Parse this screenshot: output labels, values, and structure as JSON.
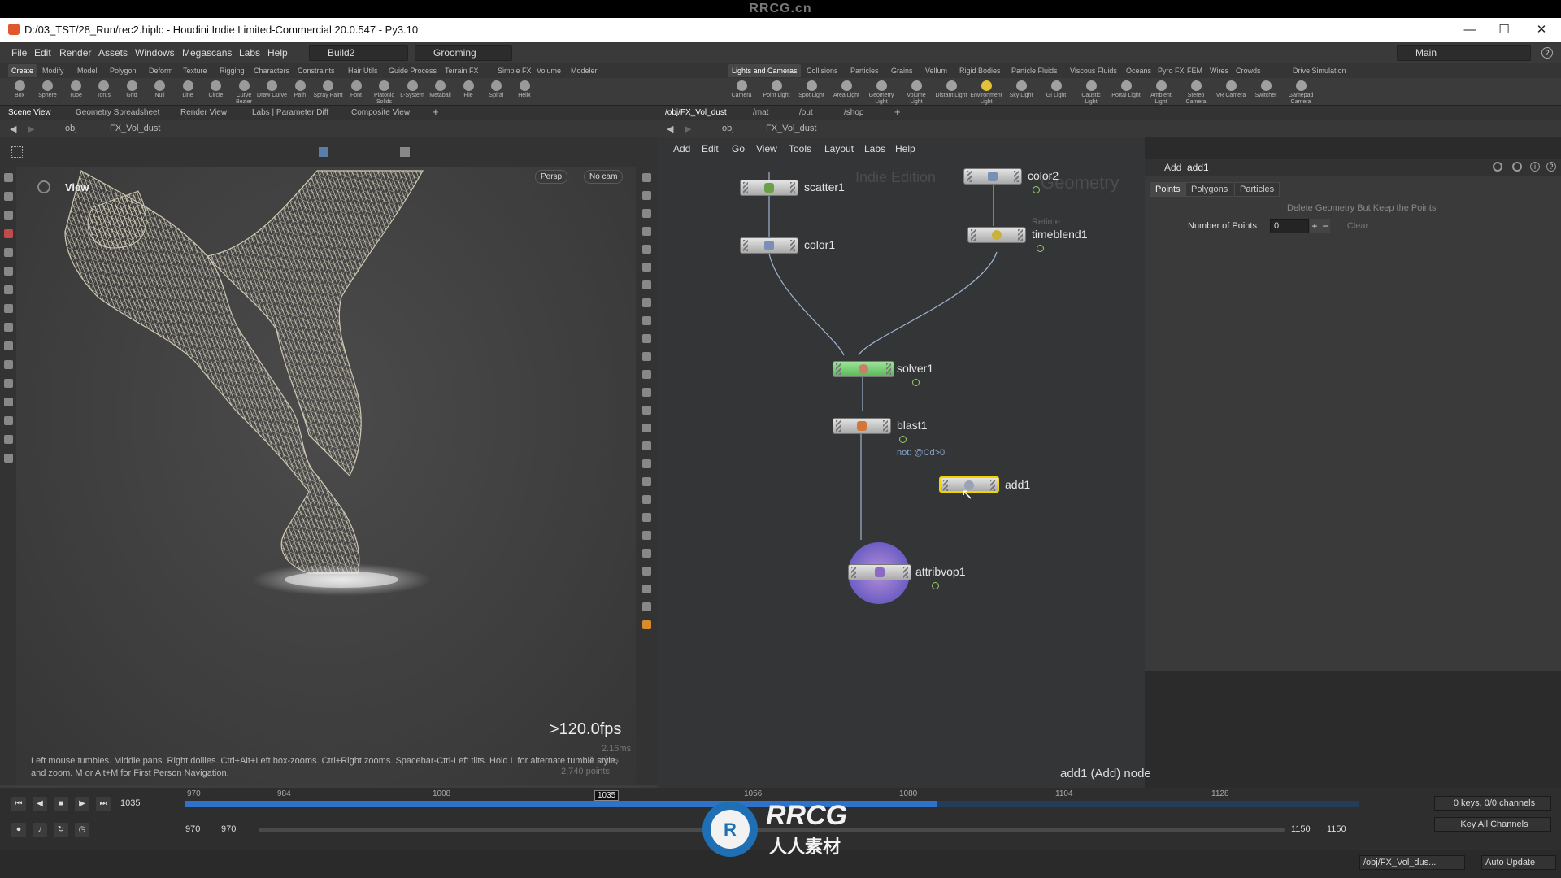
{
  "watermark_top": "RRCG.cn",
  "window": {
    "title": "D:/03_TST/28_Run/rec2.hiplc - Houdini Indie Limited-Commercial 20.0.547 - Py3.10",
    "buttons": [
      "—",
      "☐",
      "✕"
    ]
  },
  "menubar": {
    "items": [
      "File",
      "Edit",
      "Render",
      "Assets",
      "Windows",
      "Megascans",
      "Labs",
      "Help"
    ],
    "build": "Build2",
    "desktop": "Grooming",
    "main": "Main"
  },
  "shelf_tabs_left": [
    "Create",
    "Modify",
    "Model",
    "Polygon",
    "Deform",
    "Texture",
    "Rigging",
    "Characters",
    "Constraints",
    "Hair Utils",
    "Guide Process",
    "Terrain FX",
    "Simple FX",
    "Volume",
    "Modeler"
  ],
  "shelf_tabs_right": [
    "Lights and Cameras",
    "Collisions",
    "Particles",
    "Grains",
    "Vellum",
    "Rigid Bodies",
    "Particle Fluids",
    "Viscous Fluids",
    "Oceans",
    "Pyro FX",
    "FEM",
    "Wires",
    "Crowds",
    "Drive Simulation"
  ],
  "tools_left": [
    "Box",
    "Sphere",
    "Tube",
    "Torus",
    "Grid",
    "Null",
    "Line",
    "Circle",
    "Curve Bezier",
    "Draw Curve",
    "Path",
    "Spray Paint",
    "Font",
    "Platonic Solids",
    "L-System",
    "Metaball",
    "File",
    "Spiral",
    "Helix"
  ],
  "tools_right": [
    "Camera",
    "Point Light",
    "Spot Light",
    "Area Light",
    "Geometry Light",
    "Volume Light",
    "Distant Light",
    "Environment Light",
    "Sky Light",
    "GI Light",
    "Caustic Light",
    "Portal Light",
    "Ambient Light",
    "Stereo Camera",
    "VR Camera",
    "Switcher",
    "Gamepad Camera"
  ],
  "left_pane_tabs": [
    "Scene View",
    "Geometry Spreadsheet",
    "Render View",
    "Labs | Parameter Diff",
    "Composite View"
  ],
  "right_pane_tabs": [
    "/obj/FX_Vol_dust",
    "/mat",
    "/out",
    "/shop"
  ],
  "left_path": {
    "root": "obj",
    "node": "FX_Vol_dust"
  },
  "right_path": {
    "root": "obj",
    "node": "FX_Vol_dust"
  },
  "viewport": {
    "label": "View",
    "persp": "Persp",
    "cam": "No cam",
    "fps": ">120.0fps",
    "ms": "2.16ms",
    "prims": "1 prims",
    "points": "2,740 points",
    "help": "Left mouse tumbles. Middle pans. Right dollies. Ctrl+Alt+Left box-zooms. Ctrl+Right zooms. Spacebar-Ctrl-Left tilts. Hold L for alternate tumble style,",
    "help2": "and zoom. M or Alt+M for First Person Navigation."
  },
  "network": {
    "menu": [
      "Add",
      "Edit",
      "Go",
      "View",
      "Tools",
      "Layout",
      "Labs",
      "Help"
    ],
    "wm_edition": "Indie Edition",
    "wm_geometry": "Geometry",
    "nodes": {
      "scatter1": "scatter1",
      "color1": "color1",
      "color2": "color2",
      "timeblend1": "timeblend1",
      "timeblend1_sub": "Retime",
      "solver1": "solver1",
      "blast1": "blast1",
      "blast1_expr": "not: @Cd>0",
      "add1": "add1",
      "attribvop1": "attribvop1"
    },
    "status": "add1 (Add) node"
  },
  "parm": {
    "type": "Add",
    "name": "add1",
    "tabs": [
      "Points",
      "Polygons",
      "Particles"
    ],
    "delete_label": "Delete Geometry But Keep the Points",
    "num_points_label": "Number of Points",
    "num_points_value": "0",
    "clear": "Clear"
  },
  "timeline": {
    "current": "1035",
    "ticks": [
      "970",
      "984",
      "1008",
      "1035",
      "1056",
      "1080",
      "1104",
      "1128"
    ],
    "start": "970",
    "start2": "970",
    "end": "1150",
    "end2": "1150",
    "keys": "0 keys, 0/0 channels",
    "key_all": "Key All Channels",
    "path": "/obj/FX_Vol_dus...",
    "update": "Auto Update",
    "progress": 0.64
  },
  "logo": {
    "en": "RRCG",
    "cn": "人人素材"
  },
  "colors": {
    "accent": "#2e73c9",
    "selected": "#f2d500",
    "solver": "#57b957"
  }
}
